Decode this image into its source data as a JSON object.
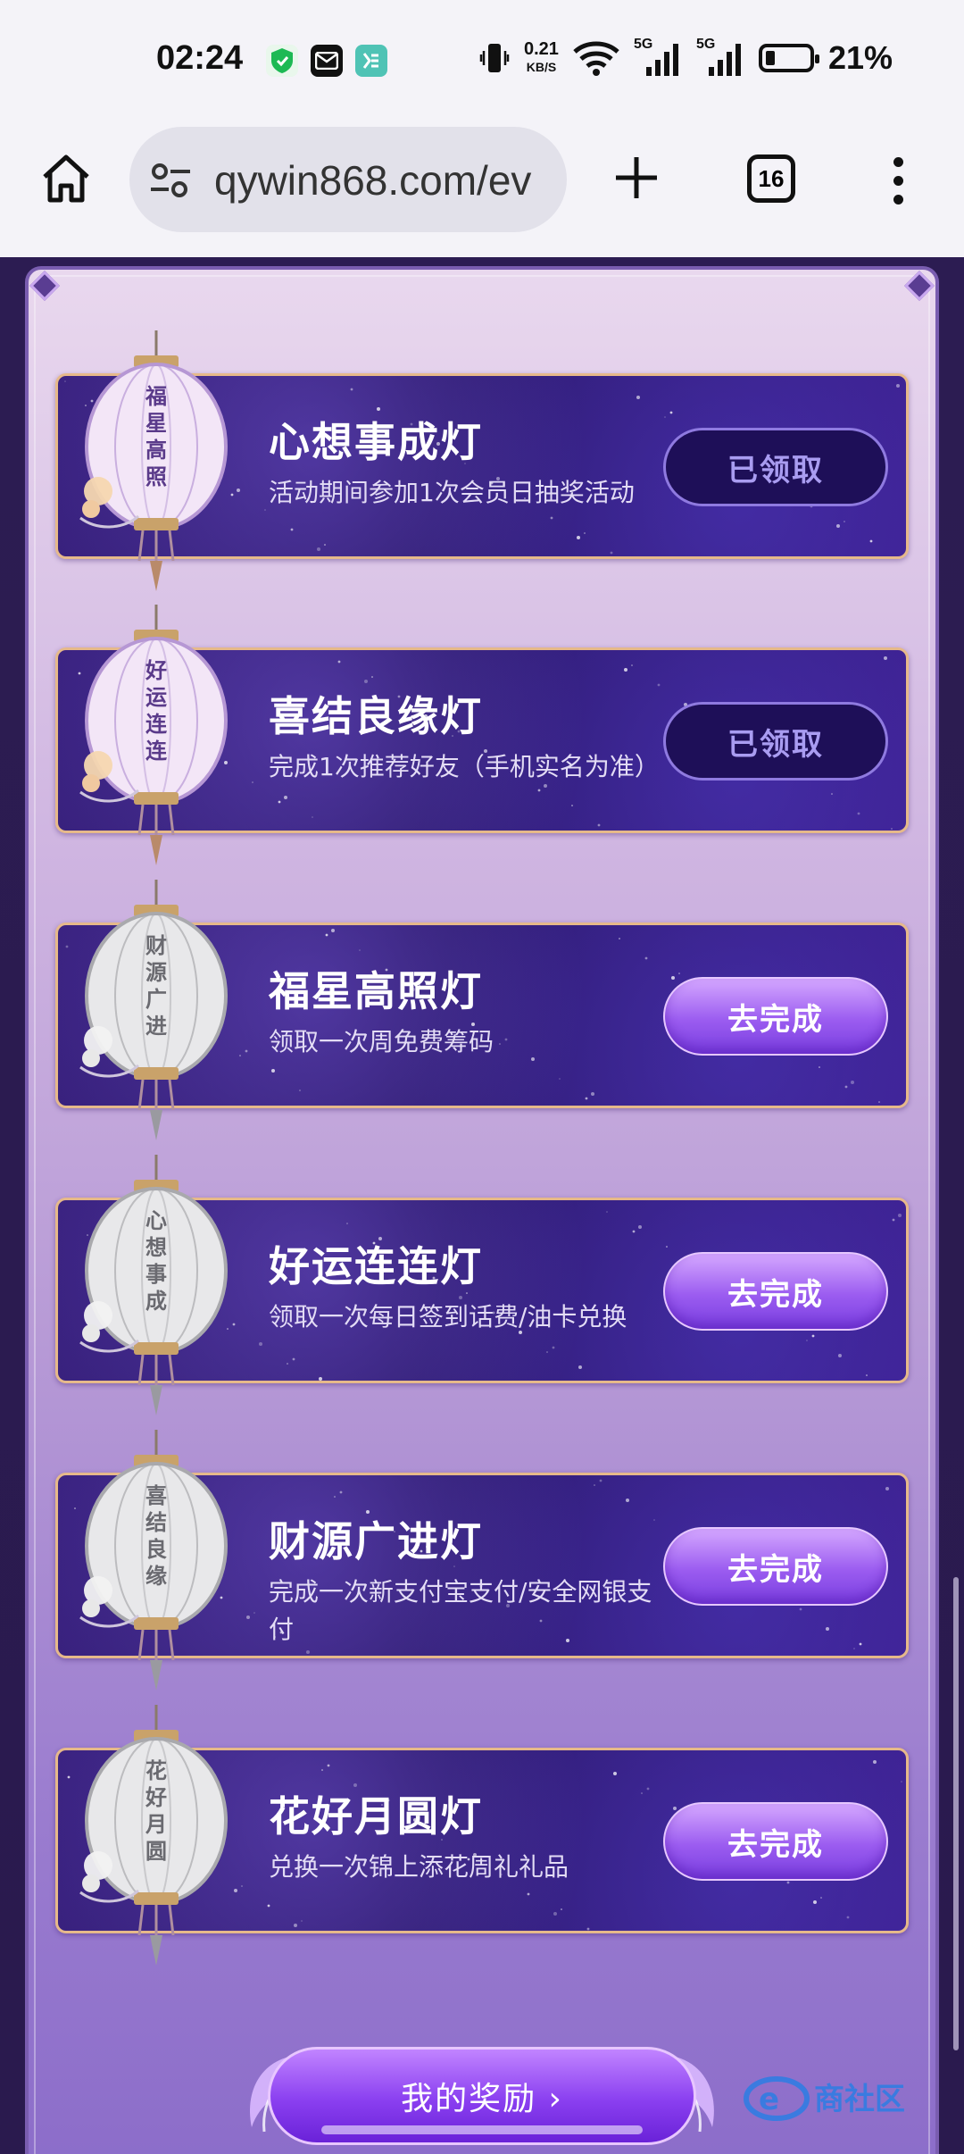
{
  "status_bar": {
    "time": "02:24",
    "net_speed": "0.21",
    "net_speed_unit": "KB/S",
    "signal_1": "5G",
    "signal_2": "5G",
    "battery": "21%"
  },
  "browser": {
    "url": "qywin868.com/ev",
    "tab_count": "16"
  },
  "tasks": [
    {
      "title": "心想事成灯",
      "desc": "活动期间参加1次会员日抽奖活动",
      "button": "已领取",
      "state": "claimed",
      "lantern_text": "福星高照"
    },
    {
      "title": "喜结良缘灯",
      "desc": "完成1次推荐好友（手机实名为准）",
      "button": "已领取",
      "state": "claimed",
      "lantern_text": "好运连连"
    },
    {
      "title": "福星高照灯",
      "desc": "领取一次周免费筹码",
      "button": "去完成",
      "state": "todo",
      "lantern_text": "财源广进"
    },
    {
      "title": "好运连连灯",
      "desc": "领取一次每日签到话费/油卡兑换",
      "button": "去完成",
      "state": "todo",
      "lantern_text": "心想事成"
    },
    {
      "title": "财源广进灯",
      "desc": "完成一次新支付宝支付/安全网银支付",
      "button": "去完成",
      "state": "todo",
      "lantern_text": "喜结良缘"
    },
    {
      "title": "花好月圆灯",
      "desc": "兑换一次锦上添花周礼礼品",
      "button": "去完成",
      "state": "todo",
      "lantern_text": "花好月圆"
    }
  ],
  "bottom_button": {
    "label": "我的奖励 ›"
  },
  "watermark": "e商社区",
  "colors": {
    "card_bg": "#2a1868",
    "card_border": "#e6b98a",
    "claimed_btn_bg": "#1e0f58",
    "todo_btn": "#9b5cf0",
    "page_bg": "#c9afe0"
  }
}
